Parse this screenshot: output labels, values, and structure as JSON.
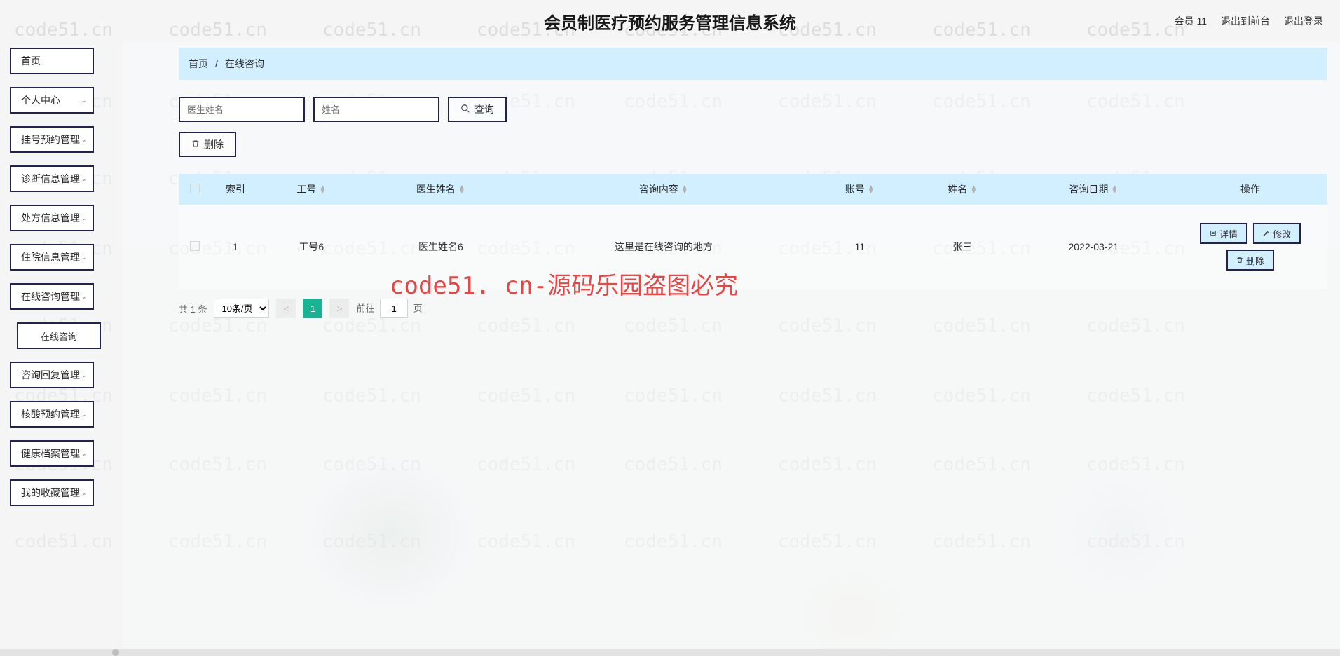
{
  "header": {
    "title": "会员制医疗预约服务管理信息系统",
    "user": "会员 11",
    "to_front": "退出到前台",
    "logout": "退出登录"
  },
  "sidebar": {
    "home": "首页",
    "items": [
      {
        "label": "个人中心"
      },
      {
        "label": "挂号预约管理"
      },
      {
        "label": "诊断信息管理"
      },
      {
        "label": "处方信息管理"
      },
      {
        "label": "住院信息管理"
      },
      {
        "label": "在线咨询管理"
      }
    ],
    "sub_active": "在线咨询",
    "items2": [
      {
        "label": "咨询回复管理"
      },
      {
        "label": "核酸预约管理"
      },
      {
        "label": "健康档案管理"
      },
      {
        "label": "我的收藏管理"
      }
    ]
  },
  "breadcrumb": {
    "home": "首页",
    "sep": "/",
    "current": "在线咨询"
  },
  "search": {
    "ph1": "医生姓名",
    "ph2": "姓名",
    "query": "查询"
  },
  "toolbar": {
    "delete": "删除"
  },
  "table": {
    "headers": {
      "idx": "索引",
      "jobno": "工号",
      "docname": "医生姓名",
      "content": "咨询内容",
      "account": "账号",
      "uname": "姓名",
      "date": "咨询日期",
      "ops": "操作"
    },
    "row": {
      "idx": "1",
      "jobno": "工号6",
      "docname": "医生姓名6",
      "content": "这里是在线咨询的地方",
      "account": "11",
      "uname": "张三",
      "date": "2022-03-21"
    },
    "ops": {
      "detail": "详情",
      "edit": "修改",
      "del": "删除"
    }
  },
  "pager": {
    "total": "共 1 条",
    "page_size": "10条/页",
    "current": "1",
    "jump1": "前往",
    "jump_val": "1",
    "jump2": "页"
  },
  "watermark": "code51.cn",
  "watermark_red": "code51. cn-源码乐园盗图必究"
}
